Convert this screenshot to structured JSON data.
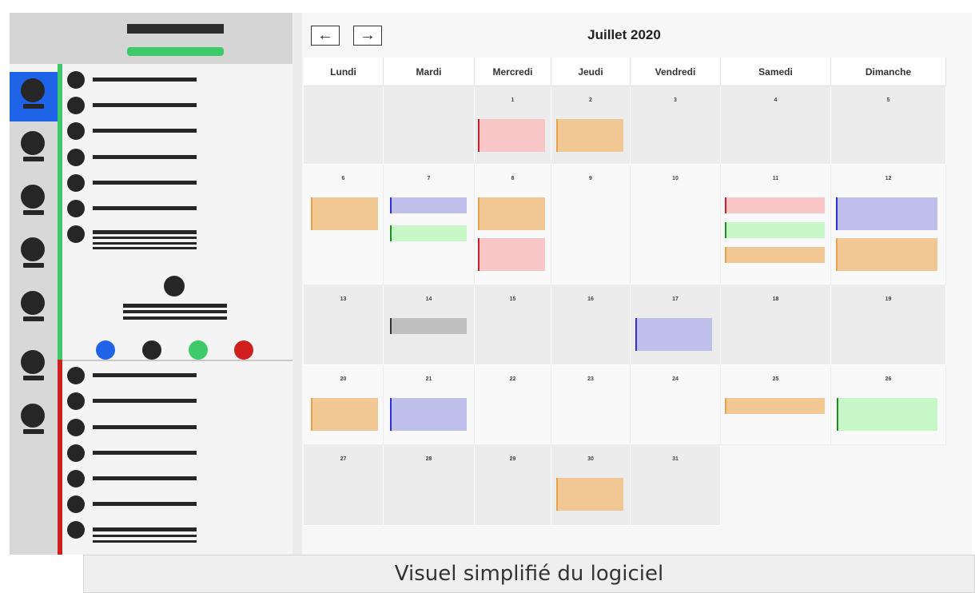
{
  "nav": {
    "prev_icon": "←",
    "next_icon": "→"
  },
  "calendar": {
    "title": "Juillet 2020",
    "weekdays": [
      "Lundi",
      "Mardi",
      "Mercredi",
      "Jeudi",
      "Vendredi",
      "Samedi",
      "Dimanche"
    ],
    "weeks": [
      [
        "",
        "",
        "1",
        "2",
        "3",
        "4",
        "5"
      ],
      [
        "6",
        "7",
        "8",
        "9",
        "10",
        "11",
        "12"
      ],
      [
        "13",
        "14",
        "15",
        "16",
        "17",
        "18",
        "19"
      ],
      [
        "20",
        "21",
        "22",
        "23",
        "24",
        "25",
        "26"
      ],
      [
        "27",
        "28",
        "29",
        "30",
        "31"
      ]
    ]
  },
  "sidebar": {
    "active_index": 0,
    "status_colors": [
      "#1f63e8",
      "#262626",
      "#3ec96a",
      "#d01f1f"
    ]
  },
  "colors": {
    "orange": "#f1c894",
    "pink": "#f8c6c6",
    "purple": "#bebfea",
    "green": "#c7f7c7",
    "grey": "#bfbfbf"
  },
  "caption": "Visuel simplifié du logiciel"
}
